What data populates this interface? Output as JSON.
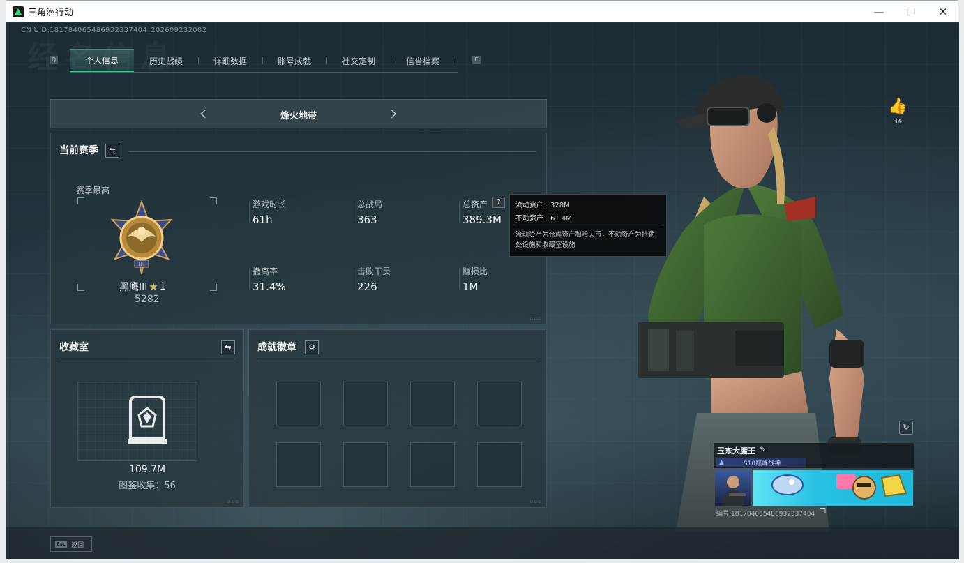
{
  "window": {
    "title": "三角洲行动",
    "minimize": "—",
    "maximize": "☐",
    "close": "✕"
  },
  "uid_line": "CN UID:1817840654869323374​04_2026092​32002",
  "ghost_title": "经名信息",
  "tabs": {
    "left_key": "Q",
    "right_key": "E",
    "items": [
      {
        "label": "个人信息",
        "active": true
      },
      {
        "label": "历史战绩",
        "active": false
      },
      {
        "label": "详细数据",
        "active": false
      },
      {
        "label": "账号成就",
        "active": false
      },
      {
        "label": "社交定制",
        "active": false
      },
      {
        "label": "信誉档案",
        "active": false
      }
    ]
  },
  "map_selector": {
    "name": "烽火地带",
    "prev_icon": "chevron-left-icon",
    "next_icon": "chevron-right-icon"
  },
  "season": {
    "title": "当前赛季",
    "highest_label": "赛季最高",
    "rank_name": "黑鹰III",
    "star_count": "1",
    "rank_score": "5282",
    "stats": [
      {
        "label": "游戏时长",
        "value": "61h"
      },
      {
        "label": "总战局",
        "value": "363"
      },
      {
        "label": "总资产",
        "value": "389.3M"
      },
      {
        "label": "撤离率",
        "value": "31.4%"
      },
      {
        "label": "击败干员",
        "value": "226"
      },
      {
        "label": "赚损比",
        "value": "1M"
      }
    ],
    "help_glyph": "?"
  },
  "tooltip": {
    "liquid": "流动资产：328M",
    "fixed": "不动资产：61.4M",
    "description": "流动资产为仓库资产和哈夫币，不动资产为特勤处设施和收藏室设施"
  },
  "collection": {
    "title": "收藏室",
    "value": "109.7M",
    "catalog": "图鉴收集：56"
  },
  "achievements": {
    "title": "成就徽章",
    "slot_count": 8
  },
  "bottom": {
    "esc_key": "Esc",
    "esc_label": "返回"
  },
  "likes": {
    "count": "34"
  },
  "player_card": {
    "name": "玉东大魔王",
    "title_badge": "S10巅峰战神",
    "id_line": "编号:181784065486932337404"
  },
  "colors": {
    "accent": "#39c98f",
    "panel": "#26343c",
    "card_blue": "#20d0e8"
  }
}
